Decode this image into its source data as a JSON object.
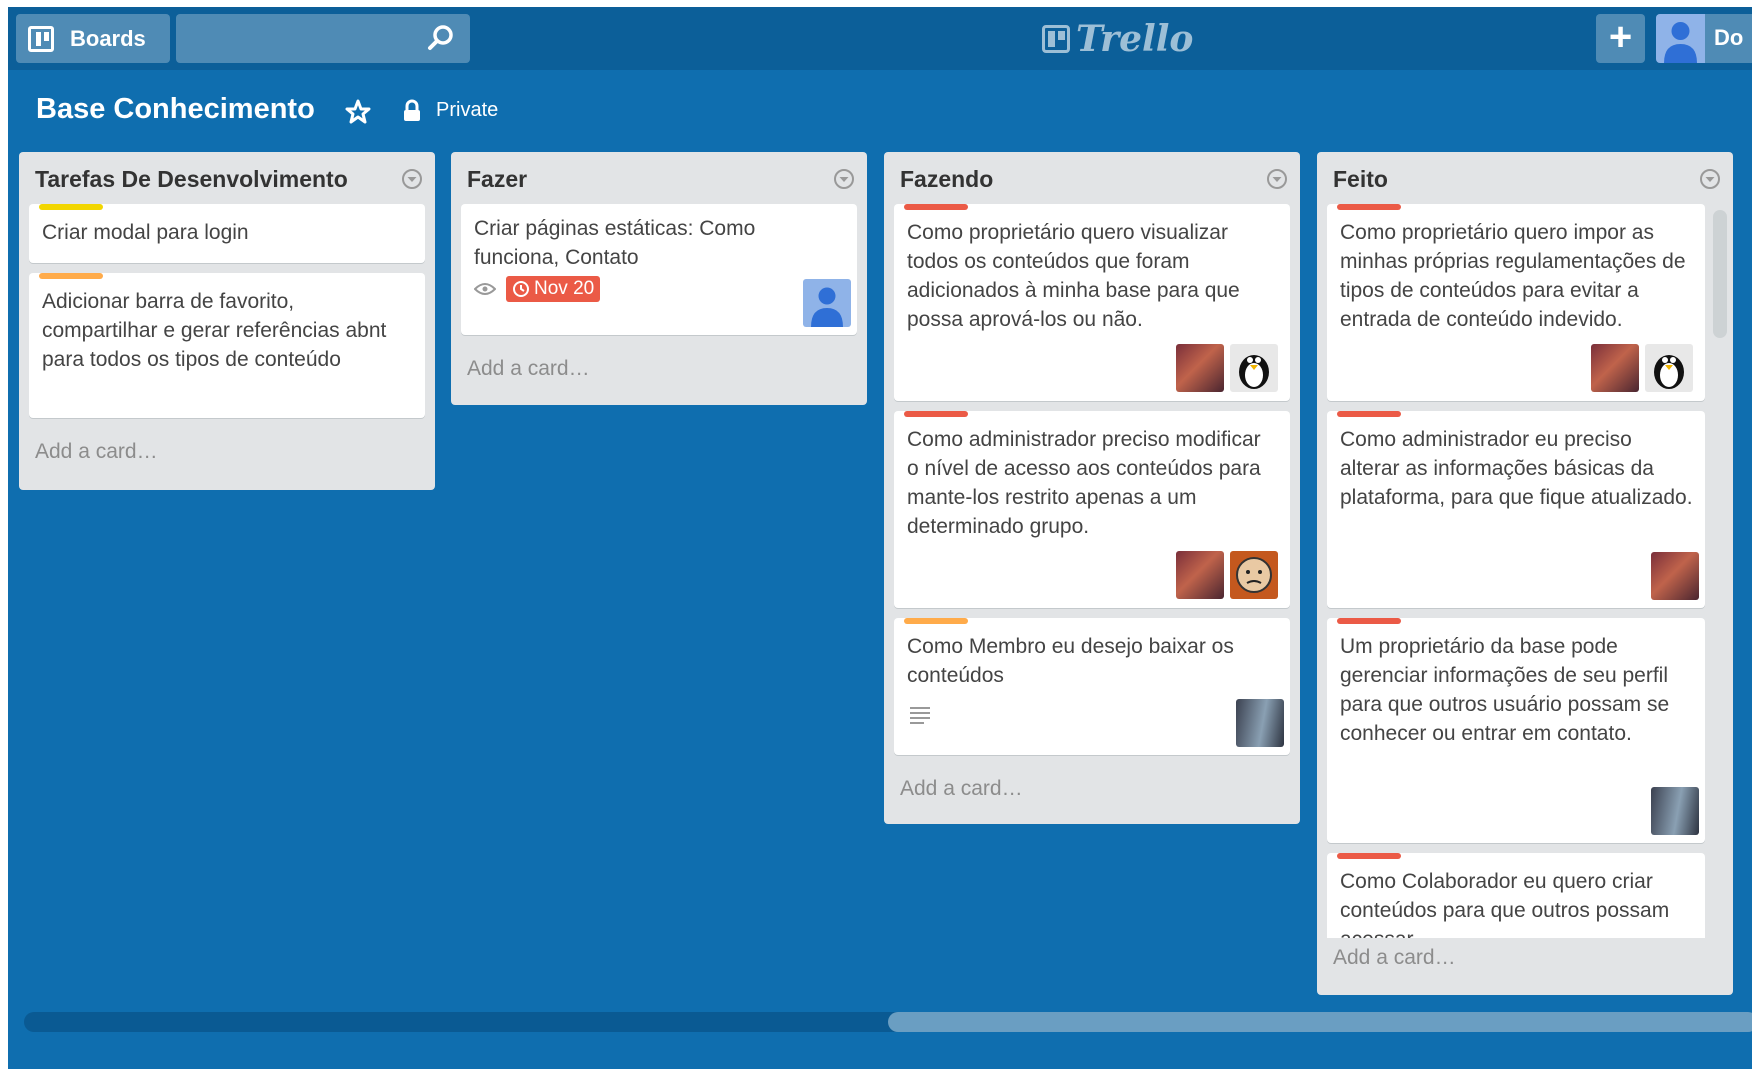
{
  "header": {
    "boards_label": "Boards",
    "search_placeholder": "",
    "logo_text": "Trello",
    "add_label": "+",
    "member_name": "Do"
  },
  "board": {
    "title": "Base Conhecimento",
    "visibility": "Private"
  },
  "colors": {
    "header_bg": "#0c5f99",
    "board_bg": "#0f6eaf",
    "list_bg": "#e2e4e6",
    "label_yellow": "#f2d600",
    "label_orange": "#ffab4a",
    "label_red": "#eb5a46"
  },
  "lists": [
    {
      "title": "Tarefas De Desenvolvimento",
      "add_card": "Add a card…",
      "cards": [
        {
          "text": "Criar modal para login",
          "label": "yellow"
        },
        {
          "text": "Adicionar barra de favorito, compartilhar e gerar referências abnt para todos os tipos de conteúdo",
          "label": "orange"
        }
      ]
    },
    {
      "title": "Fazer",
      "add_card": "Add a card…",
      "cards": [
        {
          "text": "Criar páginas estáticas: Como funciona, Contato",
          "due": "Nov 20",
          "icons": [
            "eye-icon",
            "clock-icon"
          ],
          "avatars": [
            "default-avatar"
          ]
        }
      ]
    },
    {
      "title": "Fazendo",
      "add_card": "Add a card…",
      "cards": [
        {
          "text": "Como proprietário quero visualizar todos os conteúdos que foram adicionados à minha base para que possa aprová-los ou não.",
          "label": "red",
          "avatars": [
            "photo-avatar",
            "penguin-avatar"
          ]
        },
        {
          "text": "Como administrador preciso modificar o nível de acesso aos conteúdos para mante-los restrito apenas a um determinado grupo.",
          "label": "red",
          "avatars": [
            "photo-avatar",
            "cartoon-avatar"
          ]
        },
        {
          "text": "Como Membro eu desejo baixar os conteúdos",
          "label": "orange",
          "icons": [
            "description-icon"
          ],
          "avatars": [
            "couple-avatar"
          ]
        }
      ]
    },
    {
      "title": "Feito",
      "add_card": "Add a card…",
      "cards": [
        {
          "text": "Como proprietário quero impor as minhas próprias regulamentações de tipos de conteúdos para evitar a entrada de conteúdo indevido.",
          "label": "red",
          "avatars": [
            "photo-avatar",
            "penguin-avatar"
          ]
        },
        {
          "text": "Como administrador eu preciso alterar as informações básicas da plataforma, para que fique atualizado.",
          "label": "red",
          "avatars": [
            "photo-avatar"
          ]
        },
        {
          "text": "Um proprietário da base pode gerenciar informações de seu perfil para que outros usuário possam se conhecer ou entrar em contato.",
          "label": "red",
          "avatars": [
            "couple-avatar"
          ]
        },
        {
          "text": "Como Colaborador eu quero criar conteúdos para que outros possam acessar",
          "label": "red"
        }
      ]
    }
  ]
}
